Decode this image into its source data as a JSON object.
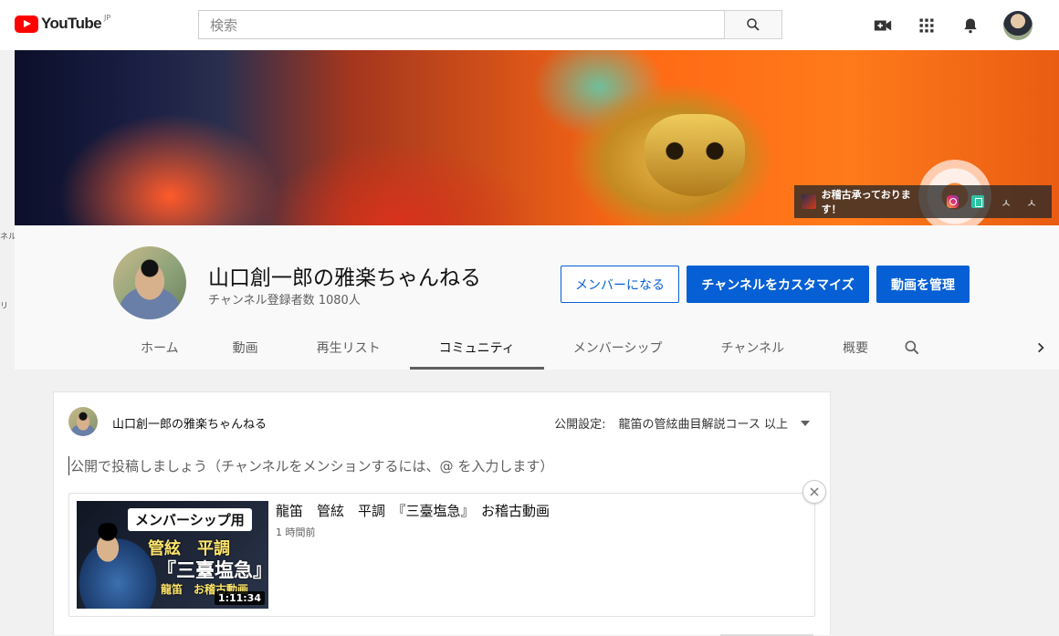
{
  "masthead": {
    "logo_text": "YouTube",
    "region": "JP",
    "search_placeholder": "検索",
    "icons": [
      "search-icon",
      "create-video-icon",
      "apps-grid-icon",
      "notifications-bell-icon",
      "account-avatar"
    ]
  },
  "banner": {
    "link_text": "お稽古承っております！",
    "link_icons": [
      "instagram-icon",
      "note-icon"
    ]
  },
  "stray_text": [
    "ネル",
    "リ"
  ],
  "channel": {
    "name": "山口創一郎の雅楽ちゃんねる",
    "subscribers": "チャンネル登録者数 1080人",
    "buttons": {
      "join": "メンバーになる",
      "customize": "チャンネルをカスタマイズ",
      "manage": "動画を管理"
    },
    "tabs": [
      "ホーム",
      "動画",
      "再生リスト",
      "コミュニティ",
      "メンバーシップ",
      "チャンネル",
      "概要"
    ],
    "active_tab": "コミュニティ"
  },
  "post": {
    "author": "山口創一郎の雅楽ちゃんねる",
    "visibility_label": "公開設定:",
    "visibility_value": "龍笛の管絃曲目解説コース 以上",
    "placeholder": "公開で投稿しましょう（チャンネルをメンションするには、@ を入力します）",
    "attachment": {
      "title": "龍笛　管絃　平調　『三臺塩急』　お稽古動画",
      "meta": "1 時間前",
      "duration": "1:11:34",
      "thumb_badge": "メンバーシップ用",
      "thumb_line1": "管絃　平調",
      "thumb_line2": "『三臺塩急』",
      "thumb_line3": "龍笛　お稽古動画"
    }
  },
  "colors": {
    "accent_blue": "#065fd4",
    "youtube_red": "#ff0000"
  }
}
